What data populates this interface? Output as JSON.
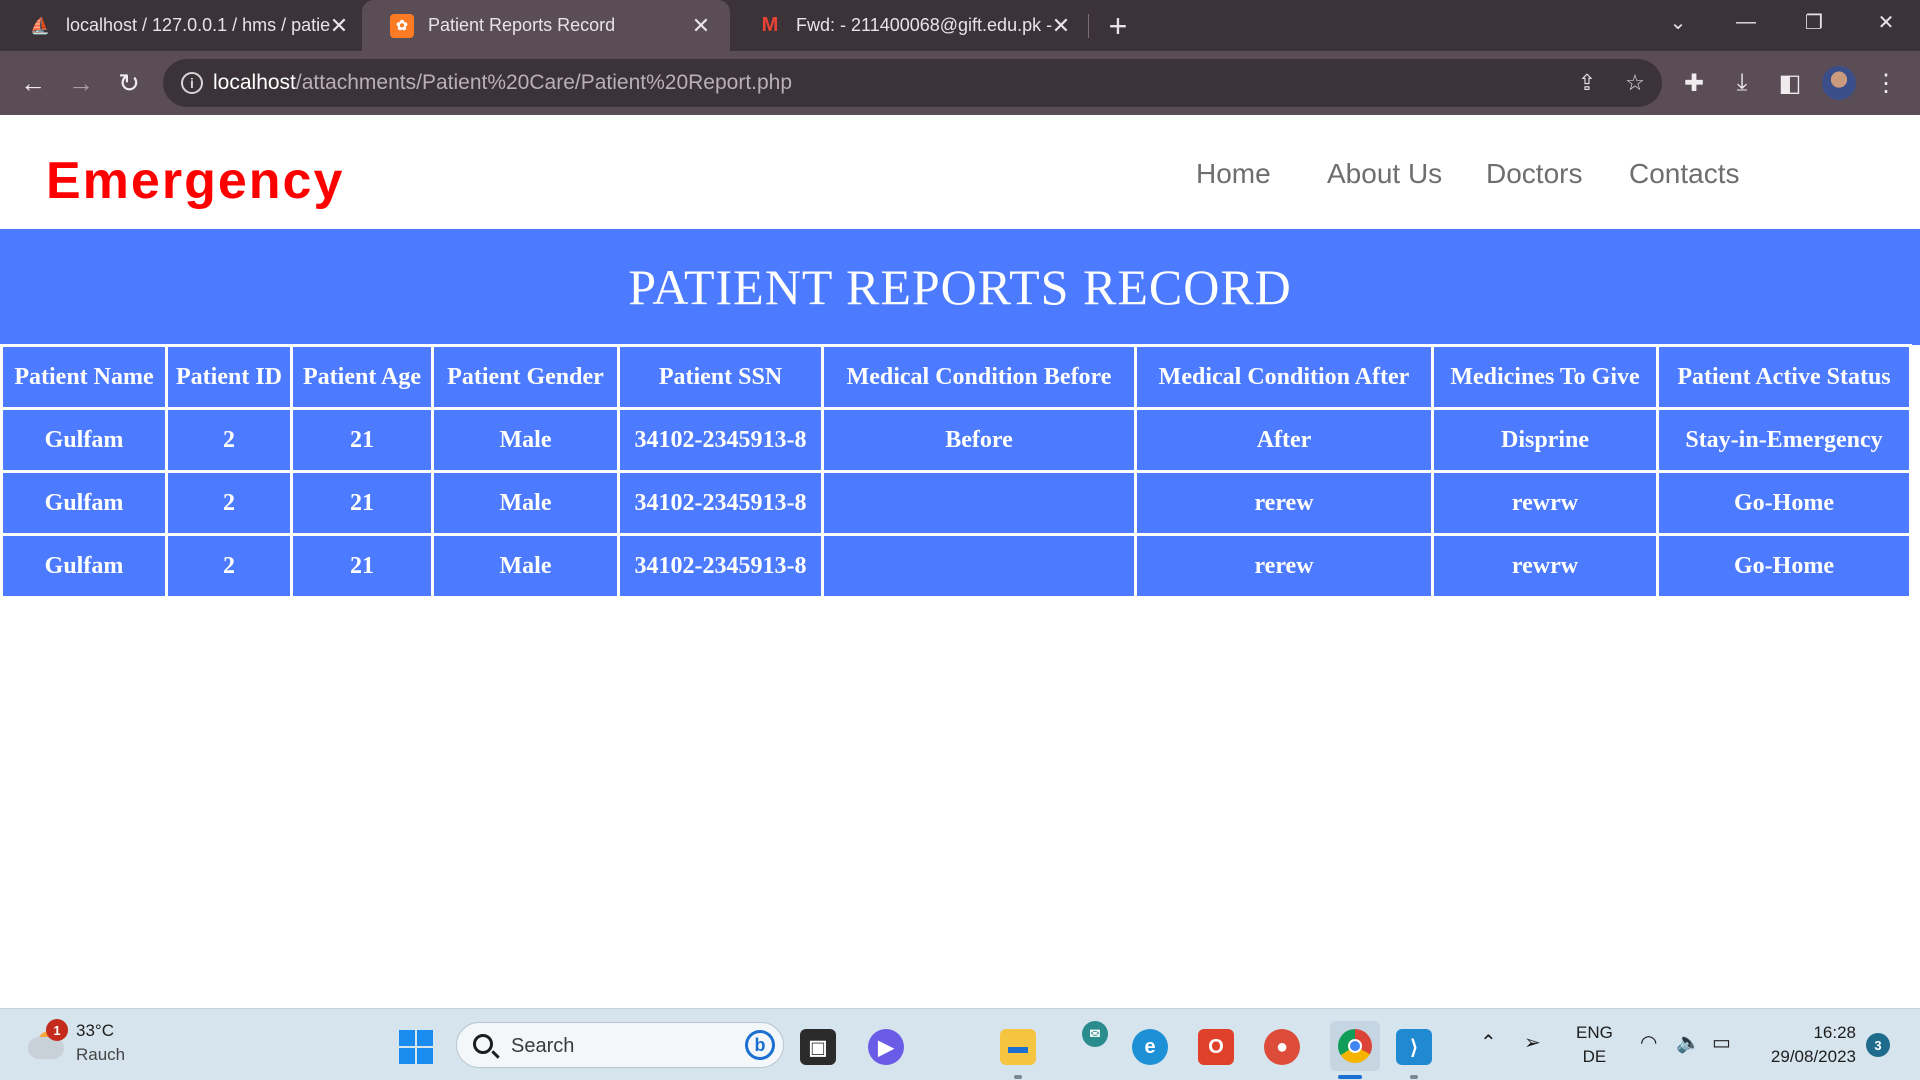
{
  "browser": {
    "tabs": [
      {
        "title": "localhost / 127.0.0.1 / hms / patie",
        "icon": "phpmyadmin-icon"
      },
      {
        "title": "Patient Reports Record",
        "icon": "xampp-icon"
      },
      {
        "title": "Fwd: - 211400068@gift.edu.pk - ",
        "icon": "gmail-icon"
      }
    ],
    "url_host": "localhost",
    "url_path": "/attachments/Patient%20Care/Patient%20Report.php"
  },
  "site": {
    "brand": "Emergency",
    "nav": [
      "Home",
      "About Us",
      "Doctors",
      "Contacts"
    ],
    "banner_title": "PATIENT REPORTS RECORD"
  },
  "table": {
    "headers": [
      "Patient Name",
      "Patient ID",
      "Patient Age",
      "Patient Gender",
      "Patient SSN",
      "Medical Condition Before",
      "Medical Condition After",
      "Medicines To Give",
      "Patient Active Status"
    ],
    "rows": [
      [
        "Gulfam",
        "2",
        "21",
        "Male",
        "34102-2345913-8",
        "Before",
        "After",
        "Disprine",
        "Stay-in-Emergency"
      ],
      [
        "Gulfam",
        "2",
        "21",
        "Male",
        "34102-2345913-8",
        "",
        "rerew",
        "rewrw",
        "Go-Home"
      ],
      [
        "Gulfam",
        "2",
        "21",
        "Male",
        "34102-2345913-8",
        "",
        "rerew",
        "rewrw",
        "Go-Home"
      ]
    ]
  },
  "taskbar": {
    "weather_temp": "33°C",
    "weather_desc": "Rauch",
    "weather_badge": "1",
    "search_label": "Search",
    "lang_top": "ENG",
    "lang_bottom": "DE",
    "time": "16:28",
    "date": "29/08/2023",
    "notification_count": "3"
  },
  "colors": {
    "brand": "#ff0000",
    "table_bg": "#4d7bff",
    "chrome_dark": "#3c3339",
    "chrome_toolbar": "#5a4d55"
  }
}
